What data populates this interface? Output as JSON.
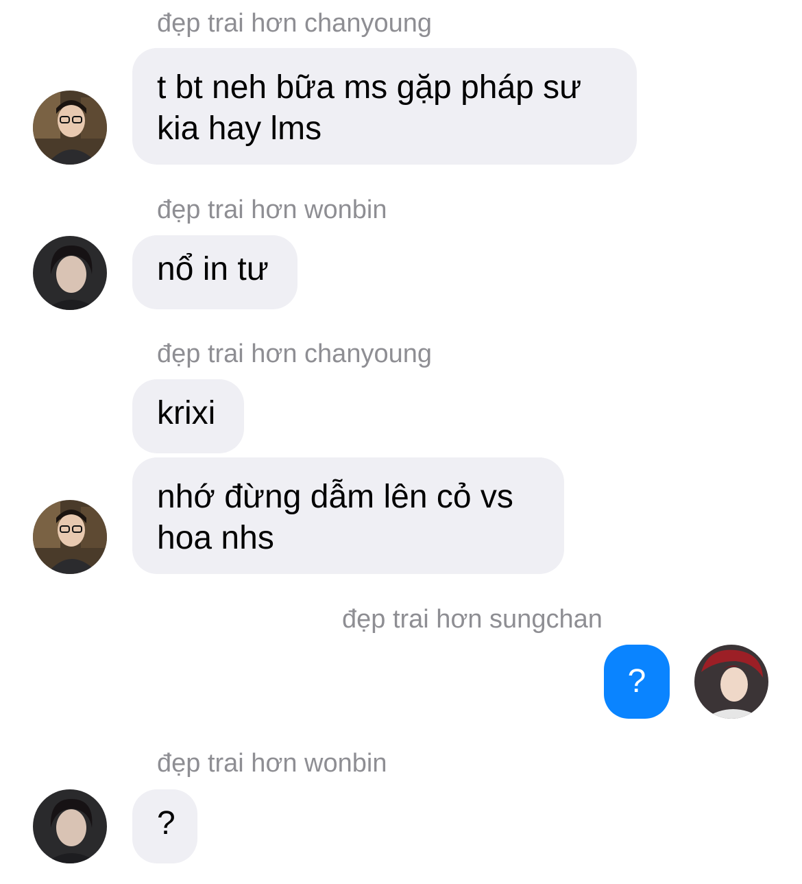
{
  "messages": [
    {
      "sender": "đẹp trai hơn chanyoung",
      "bubbles": [
        "t bt neh bữa ms gặp pháp sư\nkia hay lms"
      ],
      "avatar": "avatar-chanyoung"
    },
    {
      "sender": "đẹp trai hơn wonbin",
      "bubbles": [
        "nổ in tư"
      ],
      "avatar": "avatar-wonbin"
    },
    {
      "sender": "đẹp trai hơn chanyoung",
      "bubbles": [
        "krixi",
        "nhớ đừng dẫm lên cỏ vs\nhoa nhs"
      ],
      "avatar": "avatar-chanyoung"
    },
    {
      "sender": "đẹp trai hơn sungchan",
      "bubbles": [
        "?"
      ],
      "avatar": "avatar-sungchan",
      "outgoing": true
    },
    {
      "sender": "đẹp trai hơn wonbin",
      "bubbles": [
        "?"
      ],
      "avatar": "avatar-wonbin"
    }
  ],
  "colors": {
    "incoming_bubble": "#efeff4",
    "outgoing_bubble": "#0a84ff",
    "sender_label": "#8e8e93"
  }
}
